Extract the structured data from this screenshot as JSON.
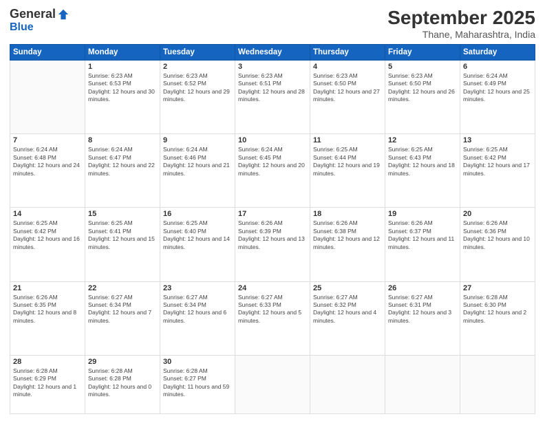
{
  "logo": {
    "general": "General",
    "blue": "Blue"
  },
  "header": {
    "month": "September 2025",
    "location": "Thane, Maharashtra, India"
  },
  "days_of_week": [
    "Sunday",
    "Monday",
    "Tuesday",
    "Wednesday",
    "Thursday",
    "Friday",
    "Saturday"
  ],
  "weeks": [
    [
      {
        "day": "",
        "sunrise": "",
        "sunset": "",
        "daylight": ""
      },
      {
        "day": "1",
        "sunrise": "Sunrise: 6:23 AM",
        "sunset": "Sunset: 6:53 PM",
        "daylight": "Daylight: 12 hours and 30 minutes."
      },
      {
        "day": "2",
        "sunrise": "Sunrise: 6:23 AM",
        "sunset": "Sunset: 6:52 PM",
        "daylight": "Daylight: 12 hours and 29 minutes."
      },
      {
        "day": "3",
        "sunrise": "Sunrise: 6:23 AM",
        "sunset": "Sunset: 6:51 PM",
        "daylight": "Daylight: 12 hours and 28 minutes."
      },
      {
        "day": "4",
        "sunrise": "Sunrise: 6:23 AM",
        "sunset": "Sunset: 6:50 PM",
        "daylight": "Daylight: 12 hours and 27 minutes."
      },
      {
        "day": "5",
        "sunrise": "Sunrise: 6:23 AM",
        "sunset": "Sunset: 6:50 PM",
        "daylight": "Daylight: 12 hours and 26 minutes."
      },
      {
        "day": "6",
        "sunrise": "Sunrise: 6:24 AM",
        "sunset": "Sunset: 6:49 PM",
        "daylight": "Daylight: 12 hours and 25 minutes."
      }
    ],
    [
      {
        "day": "7",
        "sunrise": "Sunrise: 6:24 AM",
        "sunset": "Sunset: 6:48 PM",
        "daylight": "Daylight: 12 hours and 24 minutes."
      },
      {
        "day": "8",
        "sunrise": "Sunrise: 6:24 AM",
        "sunset": "Sunset: 6:47 PM",
        "daylight": "Daylight: 12 hours and 22 minutes."
      },
      {
        "day": "9",
        "sunrise": "Sunrise: 6:24 AM",
        "sunset": "Sunset: 6:46 PM",
        "daylight": "Daylight: 12 hours and 21 minutes."
      },
      {
        "day": "10",
        "sunrise": "Sunrise: 6:24 AM",
        "sunset": "Sunset: 6:45 PM",
        "daylight": "Daylight: 12 hours and 20 minutes."
      },
      {
        "day": "11",
        "sunrise": "Sunrise: 6:25 AM",
        "sunset": "Sunset: 6:44 PM",
        "daylight": "Daylight: 12 hours and 19 minutes."
      },
      {
        "day": "12",
        "sunrise": "Sunrise: 6:25 AM",
        "sunset": "Sunset: 6:43 PM",
        "daylight": "Daylight: 12 hours and 18 minutes."
      },
      {
        "day": "13",
        "sunrise": "Sunrise: 6:25 AM",
        "sunset": "Sunset: 6:42 PM",
        "daylight": "Daylight: 12 hours and 17 minutes."
      }
    ],
    [
      {
        "day": "14",
        "sunrise": "Sunrise: 6:25 AM",
        "sunset": "Sunset: 6:42 PM",
        "daylight": "Daylight: 12 hours and 16 minutes."
      },
      {
        "day": "15",
        "sunrise": "Sunrise: 6:25 AM",
        "sunset": "Sunset: 6:41 PM",
        "daylight": "Daylight: 12 hours and 15 minutes."
      },
      {
        "day": "16",
        "sunrise": "Sunrise: 6:25 AM",
        "sunset": "Sunset: 6:40 PM",
        "daylight": "Daylight: 12 hours and 14 minutes."
      },
      {
        "day": "17",
        "sunrise": "Sunrise: 6:26 AM",
        "sunset": "Sunset: 6:39 PM",
        "daylight": "Daylight: 12 hours and 13 minutes."
      },
      {
        "day": "18",
        "sunrise": "Sunrise: 6:26 AM",
        "sunset": "Sunset: 6:38 PM",
        "daylight": "Daylight: 12 hours and 12 minutes."
      },
      {
        "day": "19",
        "sunrise": "Sunrise: 6:26 AM",
        "sunset": "Sunset: 6:37 PM",
        "daylight": "Daylight: 12 hours and 11 minutes."
      },
      {
        "day": "20",
        "sunrise": "Sunrise: 6:26 AM",
        "sunset": "Sunset: 6:36 PM",
        "daylight": "Daylight: 12 hours and 10 minutes."
      }
    ],
    [
      {
        "day": "21",
        "sunrise": "Sunrise: 6:26 AM",
        "sunset": "Sunset: 6:35 PM",
        "daylight": "Daylight: 12 hours and 8 minutes."
      },
      {
        "day": "22",
        "sunrise": "Sunrise: 6:27 AM",
        "sunset": "Sunset: 6:34 PM",
        "daylight": "Daylight: 12 hours and 7 minutes."
      },
      {
        "day": "23",
        "sunrise": "Sunrise: 6:27 AM",
        "sunset": "Sunset: 6:34 PM",
        "daylight": "Daylight: 12 hours and 6 minutes."
      },
      {
        "day": "24",
        "sunrise": "Sunrise: 6:27 AM",
        "sunset": "Sunset: 6:33 PM",
        "daylight": "Daylight: 12 hours and 5 minutes."
      },
      {
        "day": "25",
        "sunrise": "Sunrise: 6:27 AM",
        "sunset": "Sunset: 6:32 PM",
        "daylight": "Daylight: 12 hours and 4 minutes."
      },
      {
        "day": "26",
        "sunrise": "Sunrise: 6:27 AM",
        "sunset": "Sunset: 6:31 PM",
        "daylight": "Daylight: 12 hours and 3 minutes."
      },
      {
        "day": "27",
        "sunrise": "Sunrise: 6:28 AM",
        "sunset": "Sunset: 6:30 PM",
        "daylight": "Daylight: 12 hours and 2 minutes."
      }
    ],
    [
      {
        "day": "28",
        "sunrise": "Sunrise: 6:28 AM",
        "sunset": "Sunset: 6:29 PM",
        "daylight": "Daylight: 12 hours and 1 minute."
      },
      {
        "day": "29",
        "sunrise": "Sunrise: 6:28 AM",
        "sunset": "Sunset: 6:28 PM",
        "daylight": "Daylight: 12 hours and 0 minutes."
      },
      {
        "day": "30",
        "sunrise": "Sunrise: 6:28 AM",
        "sunset": "Sunset: 6:27 PM",
        "daylight": "Daylight: 11 hours and 59 minutes."
      },
      {
        "day": "",
        "sunrise": "",
        "sunset": "",
        "daylight": ""
      },
      {
        "day": "",
        "sunrise": "",
        "sunset": "",
        "daylight": ""
      },
      {
        "day": "",
        "sunrise": "",
        "sunset": "",
        "daylight": ""
      },
      {
        "day": "",
        "sunrise": "",
        "sunset": "",
        "daylight": ""
      }
    ]
  ]
}
